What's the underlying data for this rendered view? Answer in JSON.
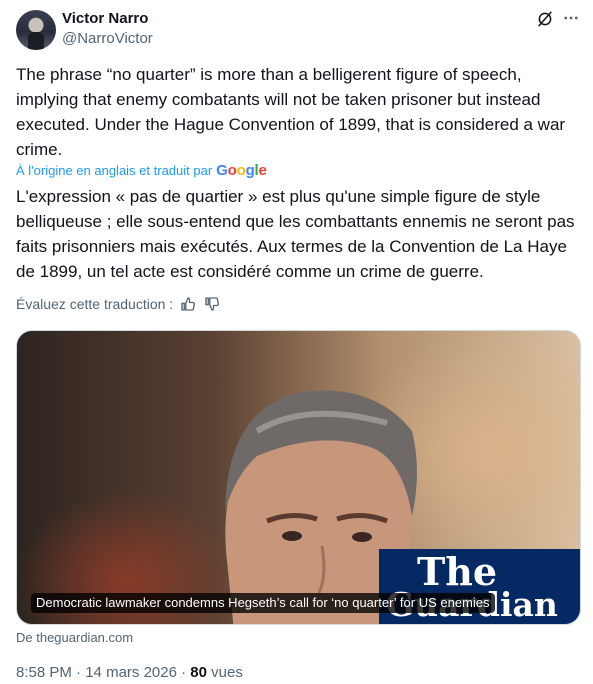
{
  "author": {
    "name": "Victor Narro",
    "handle": "@NarroVictor"
  },
  "icons": {
    "grok": "grok-icon",
    "more": "more-icon",
    "thumbs_up": "thumbs-up-icon",
    "thumbs_down": "thumbs-down-icon"
  },
  "tweet": {
    "original_text": "The phrase “no quarter” is more than a belligerent figure of speech, implying that enemy combatants will not be taken prisoner but instead executed. Under the Hague Convention of 1899, that is considered a war crime.",
    "translation_note": "À l'origine en anglais et traduit par",
    "translator_brand": "Google",
    "translated_text": "L'expression « pas de quartier » est plus qu'une simple figure de style belliqueuse ; elle sous-entend que les combattants ennemis ne seront pas faits prisonniers mais exécutés. Aux termes de la Convention de La Haye de 1899, un tel acte est considéré comme un crime de guerre.",
    "rate_translation": "Évaluez cette traduction :"
  },
  "card": {
    "logo_line1": "The",
    "logo_line2": "Guardian",
    "caption": "Democratic lawmaker condemns Hegseth’s call for ‘no quarter’ for US enemies",
    "source": "De theguardian.com"
  },
  "meta": {
    "time": "8:58 PM",
    "separator": "·",
    "date": "14 mars 2026",
    "views_count": "80",
    "views_label": "vues"
  },
  "colors": {
    "accent": "#1d9bf0",
    "text": "#0f1419",
    "secondary": "#536471",
    "guardian_blue": "#052962"
  }
}
